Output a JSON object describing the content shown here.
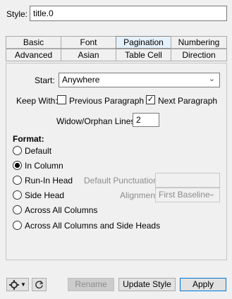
{
  "style_row": {
    "label": "Style:",
    "value": "title.0"
  },
  "tabs": {
    "row1": [
      "Basic",
      "Font",
      "Pagination",
      "Numbering"
    ],
    "row2": [
      "Advanced",
      "Asian",
      "Table Cell",
      "Direction"
    ],
    "active": "Pagination"
  },
  "pagination": {
    "start_label": "Start:",
    "start_value": "Anywhere",
    "keep_with_label": "Keep With:",
    "previous_paragraph": {
      "label": "Previous Paragraph",
      "checked": false
    },
    "next_paragraph": {
      "label": "Next Paragraph",
      "checked": true
    },
    "widow_orphan_label": "Widow/Orphan Lines:",
    "widow_orphan_value": "2",
    "format_label": "Format:",
    "format_options": [
      {
        "label": "Default",
        "checked": false
      },
      {
        "label": "In Column",
        "checked": true
      },
      {
        "label": "Run-In Head",
        "checked": false
      },
      {
        "label": "Side Head",
        "checked": false
      },
      {
        "label": "Across All Columns",
        "checked": false
      },
      {
        "label": "Across All Columns and Side Heads",
        "checked": false
      }
    ],
    "default_punctuation_label": "Default Punctuation:",
    "default_punctuation_value": "",
    "alignment_label": "Alignment:",
    "alignment_value": "First Baseline"
  },
  "footer": {
    "rename_label": "Rename",
    "update_style_label": "Update Style",
    "apply_label": "Apply"
  },
  "colors": {
    "active_tab": "#e5f1fb",
    "primary_border": "#0078d7"
  }
}
